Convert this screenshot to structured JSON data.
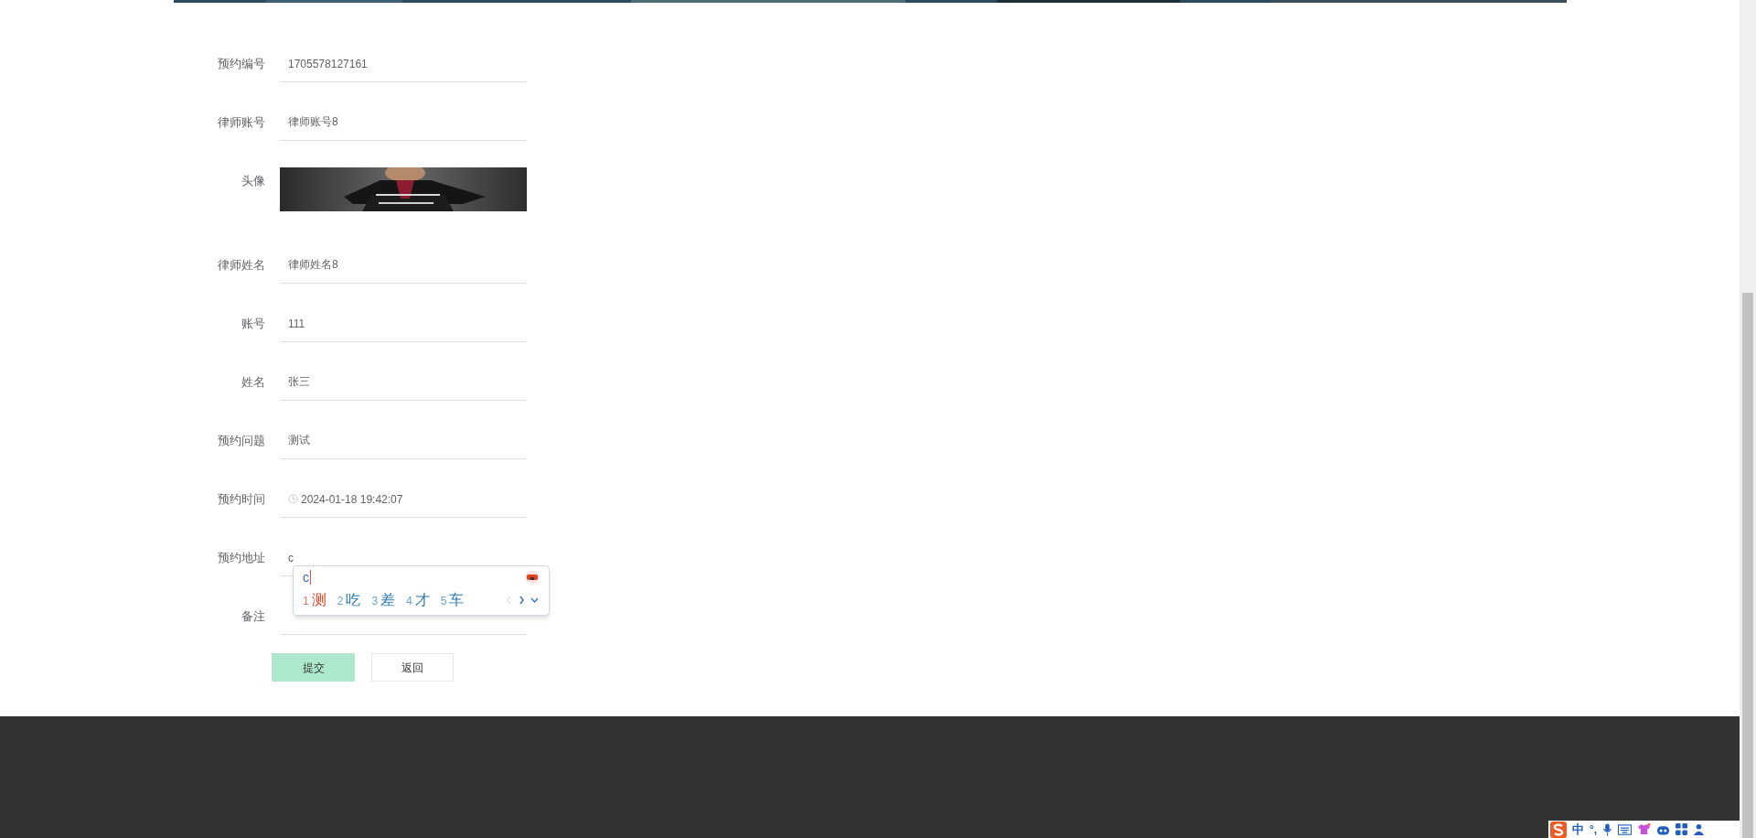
{
  "form": {
    "fields": [
      {
        "kind": "text",
        "label": "预约编号",
        "value": "1705578127161"
      },
      {
        "kind": "text",
        "label": "律师账号",
        "value": "律师账号8"
      },
      {
        "label": "头像"
      },
      {
        "kind": "text",
        "label": "律师姓名",
        "value": "律师姓名8"
      },
      {
        "kind": "text",
        "label": "账号",
        "value": "111"
      },
      {
        "kind": "text",
        "label": "姓名",
        "value": "张三"
      },
      {
        "kind": "text",
        "label": "预约问题",
        "value": "测试"
      },
      {
        "kind": "datetime",
        "label": "预约时间",
        "value": "2024-01-18 19:42:07"
      },
      {
        "kind": "text",
        "label": "预约地址",
        "value": "c"
      },
      {
        "kind": "text",
        "label": "备注"
      }
    ],
    "buttons": [
      {
        "kind": "primary",
        "label": "提交"
      },
      {
        "kind": "secondary",
        "label": "返回"
      }
    ]
  },
  "ime_popup": {
    "composition": "c",
    "candidates": [
      {
        "number": "1",
        "text": "测",
        "selected": true
      },
      {
        "number": "2",
        "text": "吃",
        "selected": false
      },
      {
        "number": "3",
        "text": "差",
        "selected": false
      },
      {
        "number": "4",
        "text": "才",
        "selected": false
      },
      {
        "number": "5",
        "text": "车",
        "selected": false
      }
    ]
  },
  "ime_toolbar": {
    "mode": "中",
    "punctuation": "°,"
  }
}
